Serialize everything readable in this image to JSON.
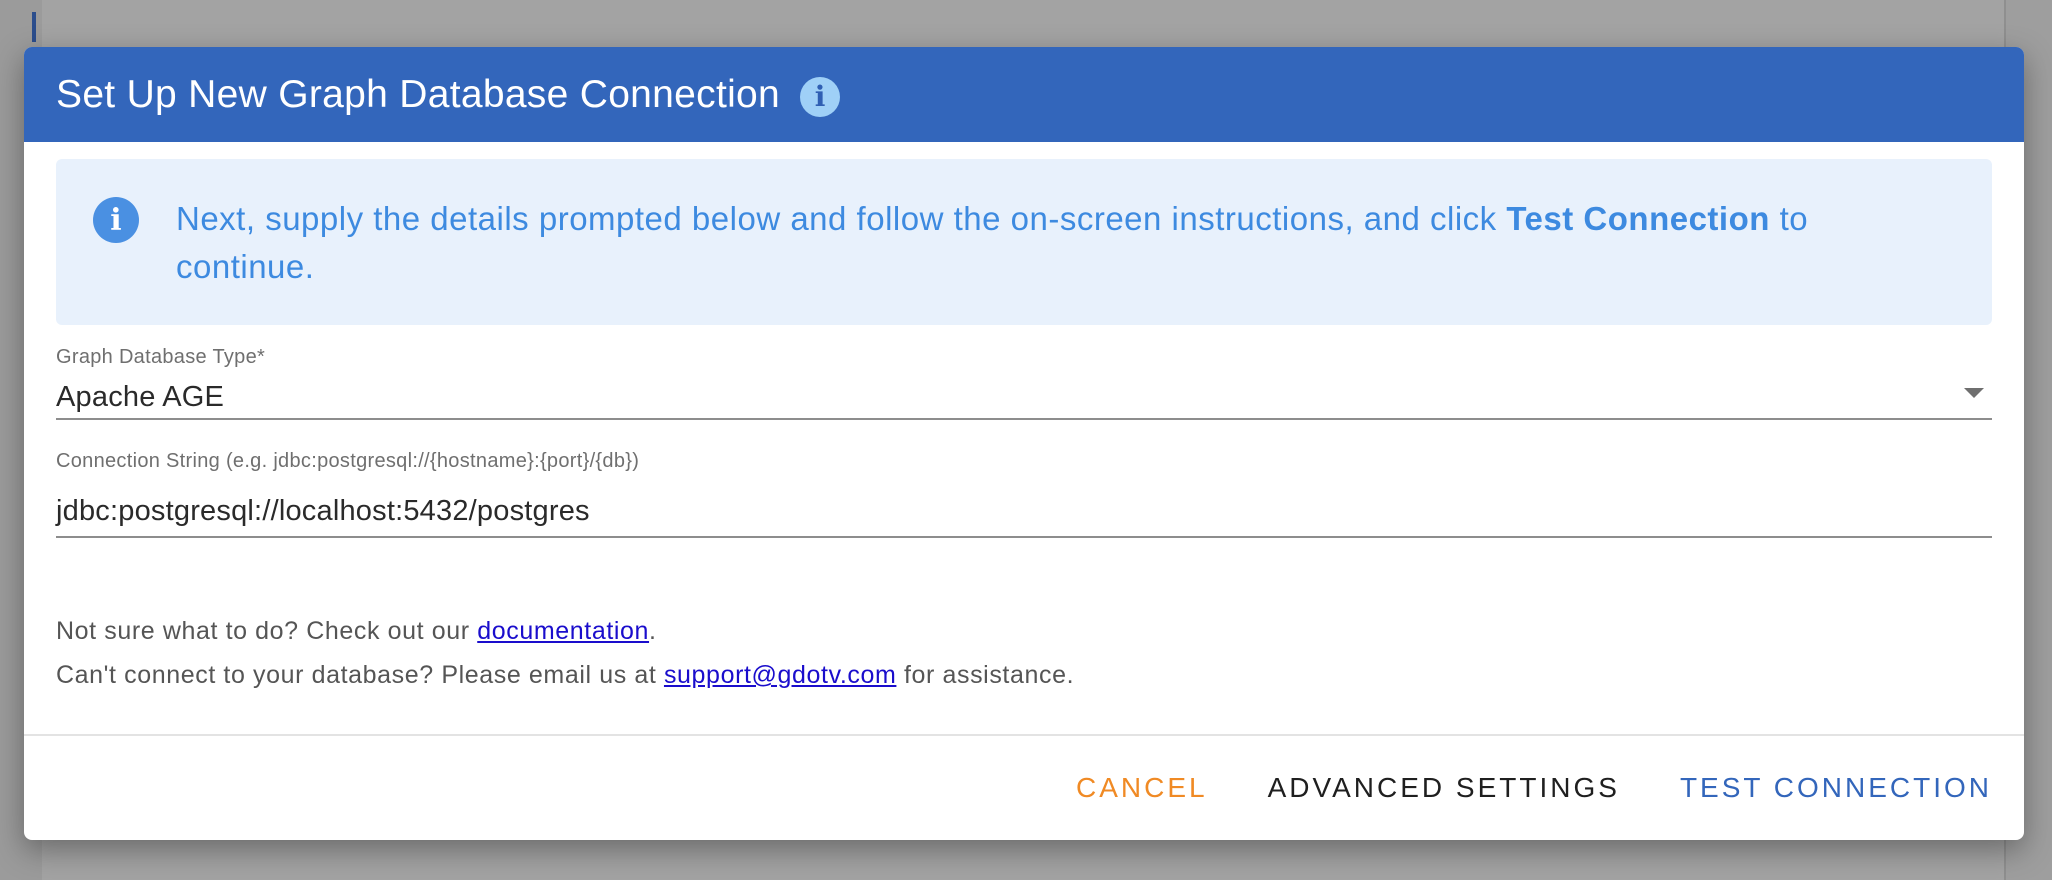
{
  "dialog": {
    "title": "Set Up New Graph Database Connection",
    "title_icon": "info-icon"
  },
  "info_box": {
    "icon": "info-icon",
    "text_before": "Next, supply the details prompted below and follow the on-screen instructions, and click ",
    "text_bold": "Test Connection",
    "text_after": " to continue."
  },
  "form": {
    "db_type": {
      "label": "Graph Database Type*",
      "value": "Apache AGE"
    },
    "connection_string": {
      "label": "Connection String (e.g. jdbc:postgresql://{hostname}:{port}/{db})",
      "value": "jdbc:postgresql://localhost:5432/postgres"
    }
  },
  "help": {
    "line1_before": "Not sure what to do? Check out our ",
    "line1_link": "documentation",
    "line1_after": ".",
    "line2_before": "Can't connect to your database? Please email us at ",
    "line2_link": "support@gdotv.com",
    "line2_after": " for assistance."
  },
  "actions": {
    "cancel": "CANCEL",
    "advanced": "ADVANCED SETTINGS",
    "test": "TEST CONNECTION"
  },
  "colors": {
    "header": "#3366bb",
    "info_bg": "#e8f1fc",
    "info_text": "#3d8ae0",
    "cancel": "#f08a24",
    "link": "#1a0dcc"
  }
}
